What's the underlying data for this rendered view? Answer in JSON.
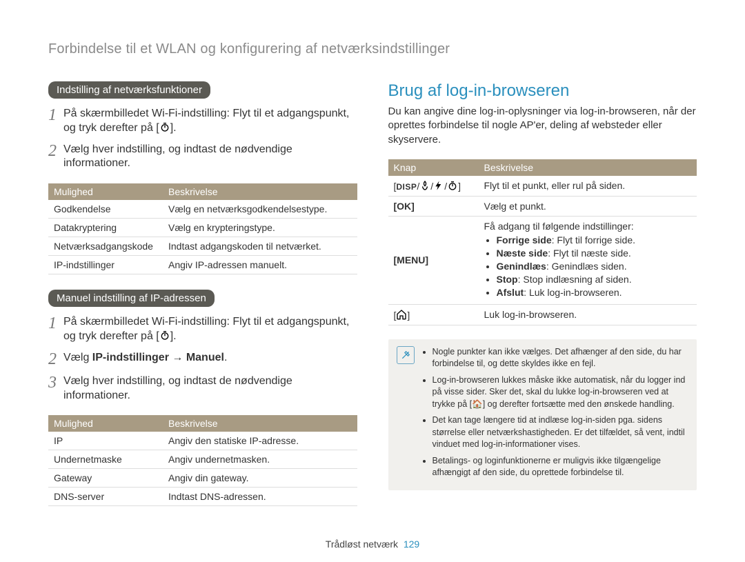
{
  "breadcrumb": "Forbindelse til et WLAN og konfigurering af netværksindstillinger",
  "left": {
    "pill1": "Indstilling af netværksfunktioner",
    "steps1": [
      "På skærmbilledet Wi-Fi-indstilling: Flyt til et adgangspunkt, og tryk derefter på [",
      "Vælg hver indstilling, og indtast de nødvendige informationer."
    ],
    "table1": {
      "h1": "Mulighed",
      "h2": "Beskrivelse",
      "rows": [
        [
          "Godkendelse",
          "Vælg en netværksgodkendelsestype."
        ],
        [
          "Datakryptering",
          "Vælg en krypteringstype."
        ],
        [
          "Netværksadgangskode",
          "Indtast adgangskoden til netværket."
        ],
        [
          "IP-indstillinger",
          "Angiv IP-adressen manuelt."
        ]
      ]
    },
    "pill2": "Manuel indstilling af IP-adressen",
    "steps2": [
      "På skærmbilledet Wi-Fi-indstilling: Flyt til et adgangspunkt, og tryk derefter på [",
      "Vælg IP-indstillinger → Manuel.",
      "Vælg hver indstilling, og indtast de nødvendige informationer."
    ],
    "table2": {
      "h1": "Mulighed",
      "h2": "Beskrivelse",
      "rows": [
        [
          "IP",
          "Angiv den statiske IP-adresse."
        ],
        [
          "Undernetmaske",
          "Angiv undernetmasken."
        ],
        [
          "Gateway",
          "Angiv din gateway."
        ],
        [
          "DNS-server",
          "Indtast DNS-adressen."
        ]
      ]
    }
  },
  "right": {
    "title": "Brug af log-in-browseren",
    "intro": "Du kan angive dine log-in-oplysninger via log-in-browseren, når der oprettes forbindelse til nogle AP'er, deling af websteder eller skyservere.",
    "table": {
      "h1": "Knap",
      "h2": "Beskrivelse",
      "rows": [
        {
          "key": "disp",
          "desc": "Flyt til et punkt, eller rul på siden."
        },
        {
          "key": "ok",
          "label": "[OK]",
          "desc": "Vælg et punkt."
        },
        {
          "key": "menu",
          "label": "[MENU]",
          "lead": "Få adgang til følgende indstillinger:",
          "items": [
            [
              "Forrige side",
              "Flyt til forrige side."
            ],
            [
              "Næste side",
              "Flyt til næste side."
            ],
            [
              "Genindlæs",
              "Genindlæs siden."
            ],
            [
              "Stop",
              "Stop indlæsning af siden."
            ],
            [
              "Afslut",
              "Luk log-in-browseren."
            ]
          ]
        },
        {
          "key": "home",
          "desc": "Luk log-in-browseren."
        }
      ]
    },
    "notes": [
      "Nogle punkter kan ikke vælges. Det afhænger af den side, du har forbindelse til, og dette skyldes ikke en fejl.",
      "Log-in-browseren lukkes måske ikke automatisk, når du logger ind på visse sider. Sker det, skal du lukke log-in-browseren ved at trykke på [🏠] og derefter fortsætte med den ønskede handling.",
      "Det kan tage længere tid at indlæse log-in-siden pga. sidens størrelse eller netværkshastigheden. Er det tilfældet, så vent, indtil vinduet med log-in-informationer vises.",
      "Betalings- og loginfunktionerne er muligvis ikke tilgængelige afhængigt af den side, du oprettede forbindelse til."
    ]
  },
  "footer": {
    "label": "Trådløst netværk",
    "page": "129"
  }
}
